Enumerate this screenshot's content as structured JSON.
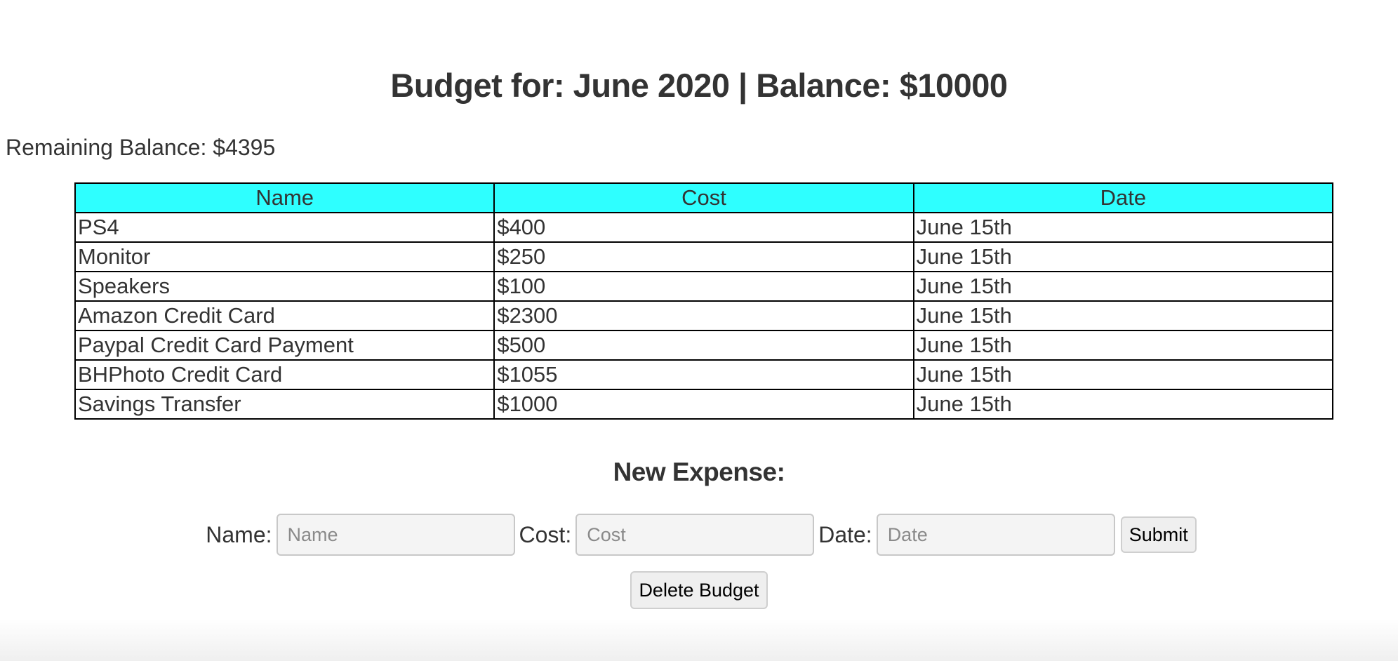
{
  "header": {
    "title": "Budget for: June 2020 | Balance: $10000"
  },
  "summary": {
    "remaining": "Remaining Balance: $4395"
  },
  "table": {
    "columns": [
      "Name",
      "Cost",
      "Date"
    ],
    "rows": [
      [
        "PS4",
        "$400",
        "June 15th"
      ],
      [
        "Monitor",
        "$250",
        "June 15th"
      ],
      [
        "Speakers",
        "$100",
        "June 15th"
      ],
      [
        "Amazon Credit Card",
        "$2300",
        "June 15th"
      ],
      [
        "Paypal Credit Card Payment",
        "$500",
        "June 15th"
      ],
      [
        "BHPhoto Credit Card",
        "$1055",
        "June 15th"
      ],
      [
        "Savings Transfer",
        "$1000",
        "June 15th"
      ]
    ]
  },
  "form": {
    "heading": "New Expense:",
    "name_label": "Name:",
    "name_placeholder": "Name",
    "name_value": "",
    "cost_label": "Cost:",
    "cost_placeholder": "Cost",
    "cost_value": "",
    "date_label": "Date:",
    "date_placeholder": "Date",
    "date_value": "",
    "submit_label": "Submit"
  },
  "actions": {
    "delete_label": "Delete Budget"
  },
  "colors": {
    "header_background": "#2effff",
    "text": "#333333",
    "border": "#000000"
  }
}
